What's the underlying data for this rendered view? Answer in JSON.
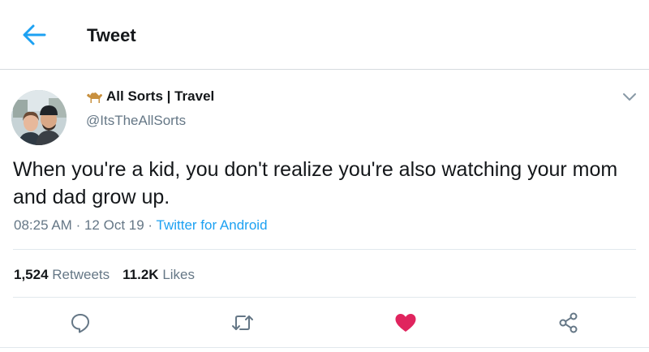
{
  "header": {
    "title": "Tweet",
    "back_icon": "arrow-left-icon"
  },
  "tweet": {
    "display_name": "All Sorts | Travel",
    "name_emoji_icon": "camel-icon",
    "handle": "@ItsTheAllSorts",
    "text": "When you're a kid, you don't realize you're also watching your mom and dad grow up.",
    "time": "08:25 AM",
    "date": "12 Oct 19",
    "source": "Twitter for Android",
    "sep": "·"
  },
  "stats": {
    "retweets_count": "1,524",
    "retweets_label": "Retweets",
    "likes_count": "11.2K",
    "likes_label": "Likes"
  },
  "actions": {
    "reply_icon": "reply-icon",
    "retweet_icon": "retweet-icon",
    "like_icon": "heart-icon",
    "share_icon": "share-icon"
  },
  "colors": {
    "accent": "#1da1f2",
    "like": "#e0245e",
    "secondary_text": "#657786"
  }
}
